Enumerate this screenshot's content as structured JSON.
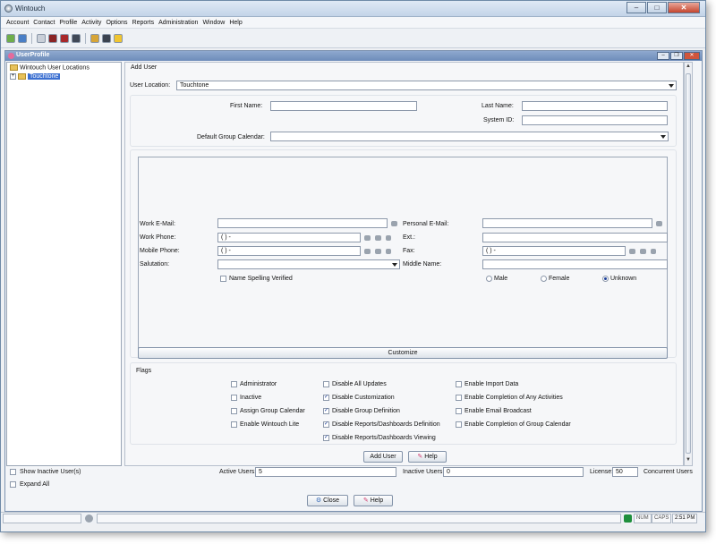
{
  "window": {
    "title": "Wintouch"
  },
  "menu": [
    "Account",
    "Contact",
    "Profile",
    "Activity",
    "Options",
    "Reports",
    "Administration",
    "Window",
    "Help"
  ],
  "toolbar_icons": [
    "contacts-icon",
    "add-contact-icon",
    "calendar-icon",
    "grid-icon",
    "library-icon",
    "task-icon",
    "settings-icon",
    "layout-icon",
    "folder-icon"
  ],
  "inner": {
    "title": "UserProfile"
  },
  "tree": {
    "root": "Wintouch User Locations",
    "child": "Touchtone"
  },
  "form": {
    "section_title": "Add User",
    "user_location_label": "User Location:",
    "user_location_value": "Touchtone",
    "first_name_label": "First Name:",
    "last_name_label": "Last Name:",
    "system_id_label": "System ID:",
    "default_calendar_label": "Default Group Calendar:",
    "work_email_label": "Work E-Mail:",
    "personal_email_label": "Personal E-Mail:",
    "work_phone_label": "Work Phone:",
    "work_phone_value": "(  )    -",
    "ext_label": "Ext.:",
    "mobile_phone_label": "Mobile Phone:",
    "mobile_phone_value": "(  )    -",
    "fax_label": "Fax:",
    "fax_value": "(  )    -",
    "salutation_label": "Salutation:",
    "middle_name_label": "Middle Name:",
    "name_spelling_label": "Name Spelling Verified",
    "gender_male": "Male",
    "gender_female": "Female",
    "gender_unknown": "Unknown",
    "customize_label": "Customize",
    "flags_title": "Flags",
    "add_user_label": "Add User",
    "help_label": "Help"
  },
  "flags": {
    "col1": [
      {
        "label": "Administrator",
        "checked": false
      },
      {
        "label": "Inactive",
        "checked": false
      },
      {
        "label": "Assign Group Calendar",
        "checked": false
      },
      {
        "label": "Enable Wintouch Lite",
        "checked": false
      }
    ],
    "col2": [
      {
        "label": "Disable All Updates",
        "checked": false
      },
      {
        "label": "Disable Customization",
        "checked": true
      },
      {
        "label": "Disable Group Definition",
        "checked": true
      },
      {
        "label": "Disable Reports/Dashboards Definition",
        "checked": true
      },
      {
        "label": "Disable Reports/Dashboards Viewing",
        "checked": true
      }
    ],
    "col3": [
      {
        "label": "Enable Import Data",
        "checked": false
      },
      {
        "label": "Enable Completion of Any Activities",
        "checked": false
      },
      {
        "label": "Enable Email Broadcast",
        "checked": false
      },
      {
        "label": "Enable Completion of Group Calendar",
        "checked": false
      }
    ]
  },
  "bottom": {
    "show_inactive_label": "Show Inactive User(s)",
    "expand_all_label": "Expand All",
    "active_users_label": "Active Users:",
    "active_users_value": "5",
    "inactive_users_label": "Inactive Users:",
    "inactive_users_value": "0",
    "license_label": "License:",
    "license_value": "50",
    "concurrent_label": "Concurrent Users",
    "close_label": "Close",
    "help_label": "Help"
  },
  "status": {
    "num": "NUM",
    "caps": "CAPS",
    "time": "2:51 PM"
  }
}
